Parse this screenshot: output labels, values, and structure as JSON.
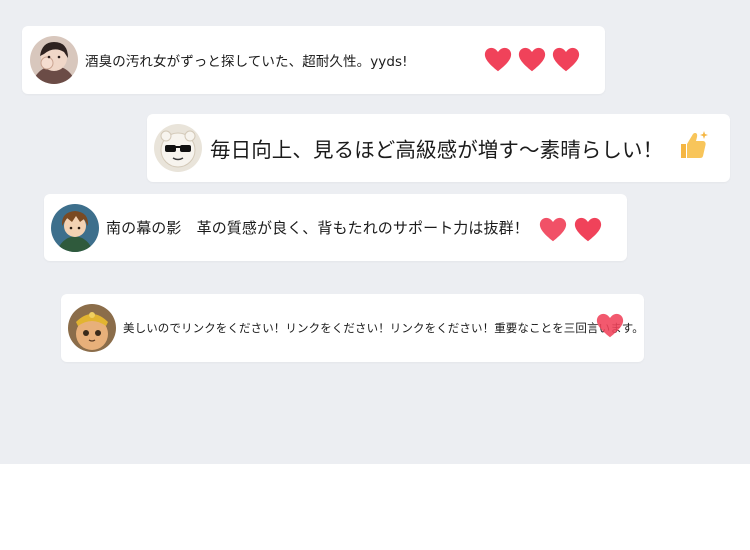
{
  "comments": [
    {
      "author_avatar": "avatar-girl-photo",
      "text": "酒臭の汚れ女がずっと探していた、超耐久性。yyds!",
      "hearts": 3
    },
    {
      "author_avatar": "avatar-sunglasses-cartoon",
      "text": "毎日向上、見るほど高級感が増す〜素晴らしい！",
      "decoration": "thumbs-up-icon"
    },
    {
      "author_avatar": "avatar-anime-boy",
      "text": "南の幕の影　革の質感が良く、背もたれのサポート力は抜群！",
      "hearts": 2
    },
    {
      "author_avatar": "avatar-cat-hat",
      "text": "美しいのでリンクをください！リンクをください！リンクをください！重要なことを三回言います。",
      "hearts": 1
    }
  ],
  "colors": {
    "background": "#eceef2",
    "bubble": "#ffffff",
    "heart": "#f0425a",
    "text": "#1b1b1b"
  }
}
